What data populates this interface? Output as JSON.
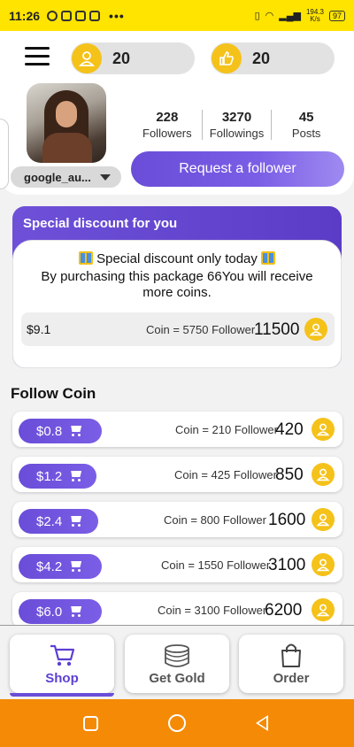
{
  "status_bar": {
    "time": "11:26",
    "net_speed_value": "194.3",
    "net_speed_unit": "K/s",
    "battery": "97"
  },
  "header": {
    "follow_coins": "20",
    "like_coins": "20",
    "username": "google_au...",
    "stats": [
      {
        "value": "228",
        "label": "Followers"
      },
      {
        "value": "3270",
        "label": "Followings"
      },
      {
        "value": "45",
        "label": "Posts"
      }
    ],
    "request_button": "Request a follower"
  },
  "discount": {
    "title": "Special discount for you",
    "line1": "Special discount only today",
    "line2": "By purchasing this package 66You will receive more coins.",
    "price": "$9.1",
    "coin_text": "Coin = 5750 Follower",
    "follower_amount": "11500"
  },
  "follow_coin": {
    "title": "Follow Coin",
    "packages": [
      {
        "price": "$0.8",
        "coin_text": "Coin = 210 Follower",
        "amount": "420"
      },
      {
        "price": "$1.2",
        "coin_text": "Coin = 425 Follower",
        "amount": "850"
      },
      {
        "price": "$2.4",
        "coin_text": "Coin = 800 Follower",
        "amount": "1600"
      },
      {
        "price": "$4.2",
        "coin_text": "Coin = 1550 Follower",
        "amount": "3100"
      },
      {
        "price": "$6.0",
        "coin_text": "Coin = 3100 Follower",
        "amount": "6200"
      }
    ]
  },
  "bottom_nav": {
    "shop": "Shop",
    "get_gold": "Get Gold",
    "order": "Order",
    "active": "Shop"
  },
  "colors": {
    "status_bar": "#ffe400",
    "accent": "#6a4dd8",
    "gold": "#f5c21a",
    "system_nav": "#f58a07"
  }
}
